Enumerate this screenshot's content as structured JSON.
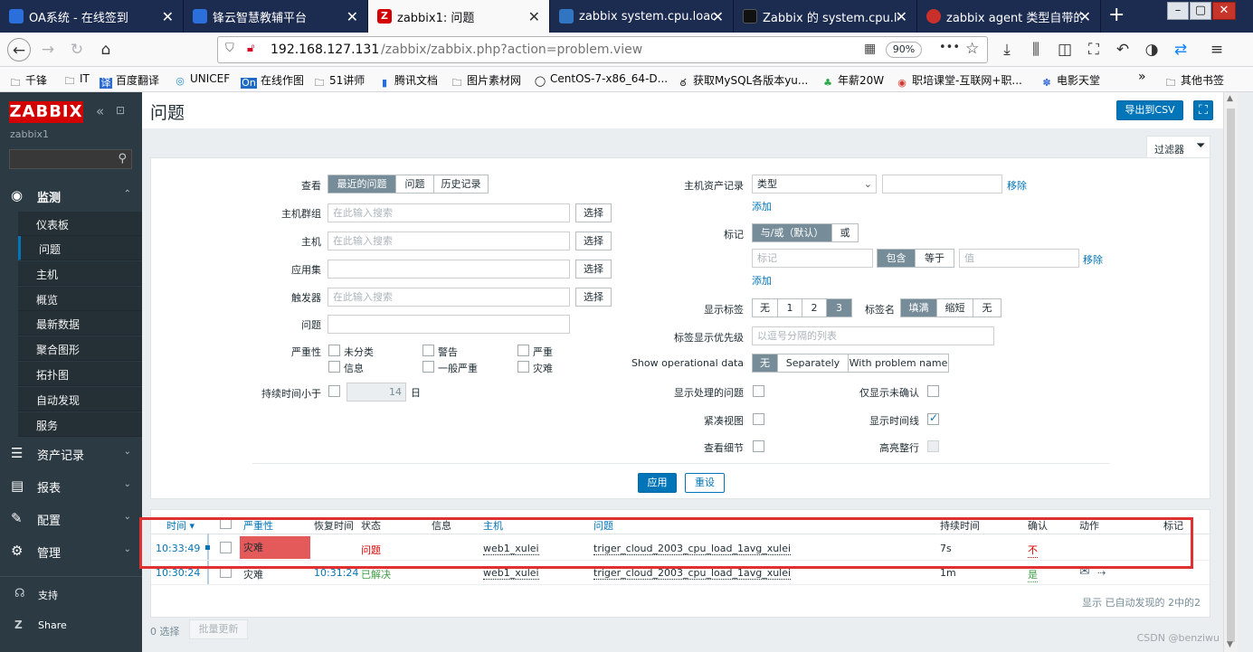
{
  "browser": {
    "tabs": [
      {
        "title": "OA系统 - 在线签到",
        "icon_color": "#2a6fdb",
        "icon": "q-logo-icon"
      },
      {
        "title": "锋云智慧教辅平台",
        "icon_color": "#2a6fdb",
        "icon": "q-logo-icon"
      },
      {
        "title": "zabbix1: 问题",
        "icon_color": "#d40000",
        "icon": "zabbix-z-icon"
      },
      {
        "title": "zabbix system.cpu.load_",
        "icon_color": "#3074c2",
        "icon": "paw-icon"
      },
      {
        "title": "Zabbix 的 system.cpu.loa",
        "icon_color": "#111111",
        "icon": "z-icon"
      },
      {
        "title": "zabbix agent 类型自带的",
        "icon_color": "#c9302c",
        "icon": "c-logo-icon"
      }
    ],
    "active_tab": 2,
    "new_tab_label": "+",
    "url_host": "192.168.127.131",
    "url_path": "/zabbix/zabbix.php?action=problem.view",
    "zoom": "90%",
    "more_label": "•••",
    "window_buttons": [
      "–",
      "▢",
      "✕"
    ],
    "bookmarks": [
      "千锋",
      "IT",
      "百度翻译",
      "UNICEF",
      "在线作图",
      "51讲师",
      "腾讯文档",
      "图片素材网",
      "CentOS-7-x86_64-D...",
      "获取MySQL各版本yu...",
      "年薪20W",
      "职培课堂-互联网+职...",
      "电影天堂"
    ],
    "bookmarks_more": "»",
    "other_bookmarks": "其他书签"
  },
  "sidebar": {
    "logo": "ZABBIX",
    "server_name": "zabbix1",
    "menu": [
      {
        "label": "监测",
        "icon": "eye-icon"
      },
      {
        "label": "资产记录",
        "icon": "list-icon"
      },
      {
        "label": "报表",
        "icon": "chart-icon"
      },
      {
        "label": "配置",
        "icon": "wrench-icon"
      },
      {
        "label": "管理",
        "icon": "gear-icon"
      }
    ],
    "monitoring_sub": [
      "仪表板",
      "问题",
      "主机",
      "概览",
      "最新数据",
      "聚合图形",
      "拓扑图",
      "自动发现",
      "服务"
    ],
    "support": "支持",
    "share": "Share"
  },
  "page": {
    "title": "问题",
    "export_csv": "导出到CSV",
    "filter_tab": "过滤器"
  },
  "filter": {
    "view_label": "查看",
    "view_options": [
      "最近的问题",
      "问题",
      "历史记录"
    ],
    "host_groups_label": "主机群组",
    "hosts_label": "主机",
    "application_label": "应用集",
    "triggers_label": "触发器",
    "problem_label": "问题",
    "severity_label": "严重性",
    "search_placeholder": "在此输入搜索",
    "select_button": "选择",
    "severities": [
      "未分类",
      "警告",
      "严重",
      "信息",
      "一般严重",
      "灾难"
    ],
    "age_label": "持续时间小于",
    "age_value": "14",
    "age_unit": "日",
    "inventory_label": "主机资产记录",
    "inventory_select": "类型",
    "remove": "移除",
    "add": "添加",
    "tags_label": "标记",
    "tags_op": [
      "与/或（默认）",
      "或"
    ],
    "tag_placeholder": "标记",
    "tag_match": [
      "包含",
      "等于"
    ],
    "value_placeholder": "值",
    "show_tags_label": "显示标签",
    "show_tags": [
      "无",
      "1",
      "2",
      "3"
    ],
    "tag_name_label": "标签名",
    "tag_name_options": [
      "填满",
      "缩短",
      "无"
    ],
    "tag_priority_label": "标签显示优先级",
    "tag_priority_placeholder": "以逗号分隔的列表",
    "op_data_label": "Show operational data",
    "op_data_options": [
      "无",
      "Separately",
      "With problem name"
    ],
    "show_suppressed": "显示处理的问题",
    "unack_only": "仅显示未确认",
    "compact_view": "紧凑视图",
    "show_timeline": "显示时间线",
    "show_details": "查看细节",
    "highlight_row": "高亮整行",
    "apply": "应用",
    "reset": "重设"
  },
  "table": {
    "headers": {
      "time": "时间 ▾",
      "severity": "严重性",
      "recovery": "恢复时间",
      "status": "状态",
      "info": "信息",
      "host": "主机",
      "problem": "问题",
      "duration": "持续时间",
      "ack": "确认",
      "actions": "动作",
      "tags": "标记"
    },
    "rows": [
      {
        "time": "10:33:49",
        "severity": "灾难",
        "recovery": "",
        "status": "问题",
        "host": "web1_xulei",
        "problem": "triger_cloud_2003_cpu_load_1avg_xulei",
        "duration": "7s",
        "ack": "不"
      },
      {
        "time": "10:30:24",
        "severity": "灾难",
        "recovery": "10:31:24",
        "status": "已解决",
        "host": "web1_xulei",
        "problem": "triger_cloud_2003_cpu_load_1avg_xulei",
        "duration": "1m",
        "ack": "是"
      }
    ],
    "footer": "显示 已自动发现的 2中的2",
    "selected": "0 选择",
    "mass_update": "批量更新"
  },
  "watermark": "CSDN @benziwu",
  "colors": {
    "disaster": "#e45959",
    "problem_red": "#dc0000",
    "resolved_green": "#429e47",
    "link_blue": "#0275b8",
    "sidebar": "#2b3a43"
  }
}
